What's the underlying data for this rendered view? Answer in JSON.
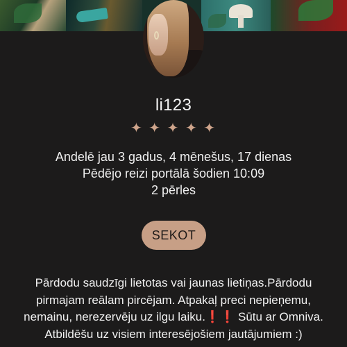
{
  "profile": {
    "username": "li123",
    "rating_icons": [
      "✦",
      "✦",
      "✦",
      "✦",
      "✦"
    ],
    "stats": {
      "member_since": "Andelē jau 3 gadus, 4 mēnešus, 17 dienas",
      "last_seen": "Pēdējo reizi portālā šodien 10:09",
      "pearls": "2 pērles"
    },
    "follow_label": "SEKOT",
    "bio": {
      "part1": "Pārdodu saudzīgi lietotas vai jaunas lietiņas.Pārdodu pirmajam reālam pircējam. Atpakaļ preci nepieņemu, nemainu, nerezervēju uz ilgu laiku.",
      "exclamations": "❗❗",
      "part2": " Sūtu ar Omniva. Atbildēšu uz visiem interesējošiem jautājumiem :)"
    }
  },
  "colors": {
    "background": "#1c1b1b",
    "accent": "#c79f86",
    "text": "#f0f0f0"
  }
}
